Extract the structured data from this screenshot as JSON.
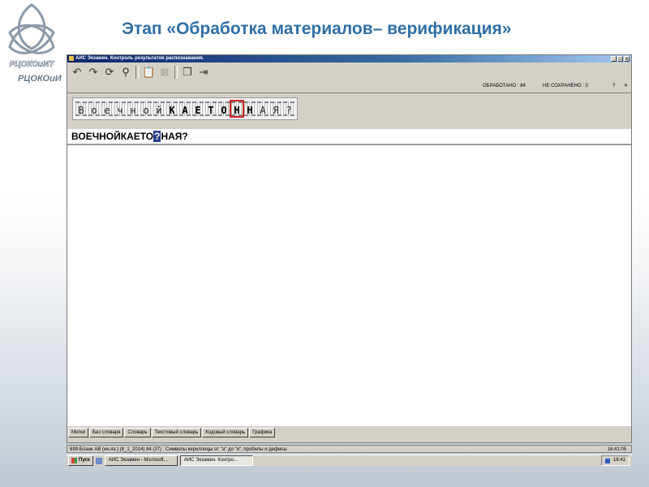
{
  "slide": {
    "title": "Этап «Обработка материалов– верификация»",
    "logo_text": "РЦОКОиИТ",
    "logo_sub": "РЦОКОиИ"
  },
  "window": {
    "title": "АИС Экзамен. Контроль результатов распознавания.",
    "processed": "ОБРАБОТАНО : 84",
    "not_saved": "НЕ СОХРАНЕНО : 0",
    "help": "?",
    "close": "✕"
  },
  "toolbar": {
    "icons": [
      "undo-icon",
      "redo-icon",
      "rotate-icon",
      "search-icon",
      "paste-icon",
      "delete-icon",
      "copy-icon",
      "exit-icon"
    ]
  },
  "image_strip": {
    "chars": [
      "В",
      "о",
      "е",
      "ч",
      "н",
      "о",
      "й",
      "К",
      "А",
      "Е",
      "Т",
      "О",
      "Н",
      "Н",
      "А",
      "Я",
      "?"
    ]
  },
  "recognized": {
    "before": "ВОЕЧНОЙКАЕТО",
    "uncertain": "?",
    "after": "НАЯ?"
  },
  "tabs": [
    "Метки",
    "Без словаря",
    "Словарь",
    "Текстовый словарь",
    "Кодовый словарь",
    "Графика"
  ],
  "statusbar": {
    "left": "699-Бланк АВ (ин.яз.) (8_1_2014)    84 (37) : Символы кириллицы от \"а\" до \"я\", пробелы и дефисы",
    "time": "16:41:05"
  },
  "taskbar": {
    "start": "Пуск",
    "tasks": [
      "АИС Экзамен - Microsoft...",
      "АИС Экзамен. Контро..."
    ],
    "clock": "16:41"
  },
  "colors": {
    "title": "#2e6fa6",
    "titlebar": "#0a246a",
    "highlight": "#d02020",
    "uncertain": "#2b3f8c"
  }
}
